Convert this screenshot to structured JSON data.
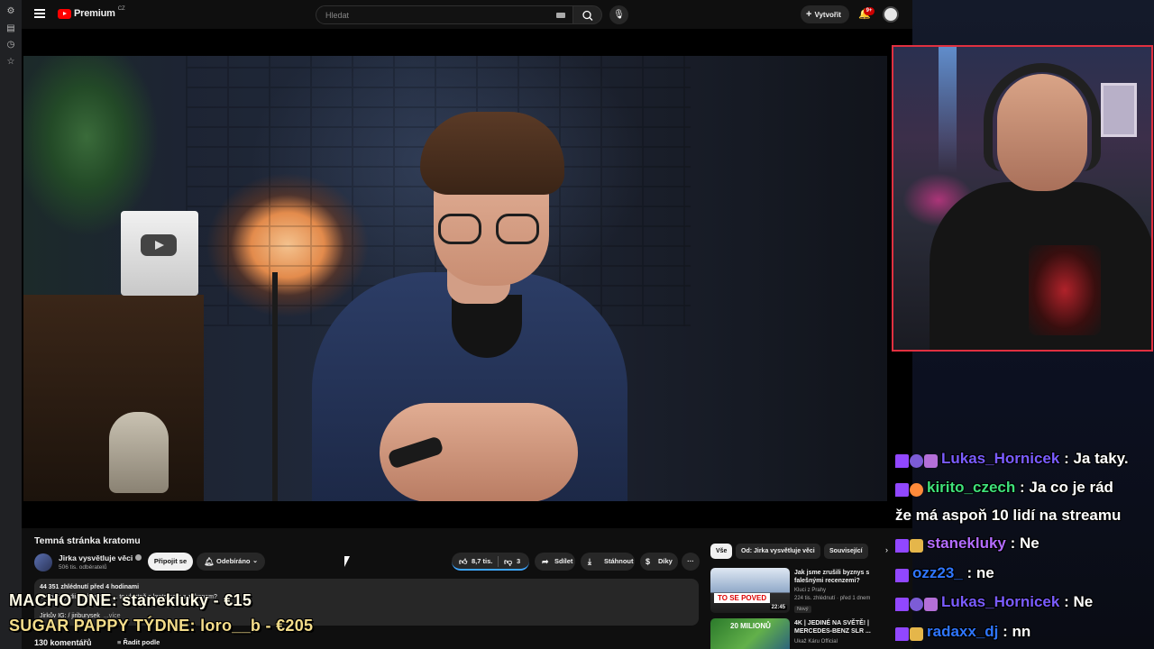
{
  "youtube": {
    "brand": "Premium",
    "country": "CZ",
    "search_placeholder": "Hledat",
    "create_label": "Vytvořit",
    "notifications_badge": "9+",
    "video_title": "Temná stránka kratomu",
    "channel_name": "Jirka vysvětluje věci",
    "subscribers": "506 tis. odběratelů",
    "join_label": "Připojit se",
    "subscribed_label": "Odebíráno",
    "likes": "8,7 tis.",
    "dislikes": "3",
    "share_label": "Sdílet",
    "download_label": "Stáhnout",
    "thanks_label": "Díky",
    "more_label": "···",
    "description": {
      "meta": "44 351 zhlédnutí  před 4 hodinami",
      "line2": "ide o tragédii... závislost? ... to vlastně s kratomem a zákonem?",
      "line3": "Jirkův IG:  / jiriburysek",
      "more": "...více"
    },
    "comments_count": "130 komentářů",
    "sort_label": "Řadit podle",
    "chips": [
      "Vše",
      "Od: Jirka vysvětluje věci",
      "Související"
    ],
    "recommendations": [
      {
        "title": "Jak jsme zrušili byznys s falešnými recenzemi?",
        "channel": "Kluci z Prahy",
        "meta": "224 tis. zhlédnutí · před 1 dnem",
        "badge": "Nový",
        "duration": "22:45",
        "thumb_text": "TO SE POVED"
      },
      {
        "title": "4K | JEDINÉ NA SVĚTĚ! | MERCEDES-BENZ SLR ...",
        "channel": "Ukaž Káru Official",
        "meta": "",
        "badge": "",
        "duration": "",
        "thumb_text": "20 MILIONŮ"
      }
    ]
  },
  "chat": [
    {
      "user": "Lukas_Hornicek",
      "message": "Ja taky.",
      "color": "#7a5cff",
      "badges": [
        "tw",
        "sub",
        "gift"
      ]
    },
    {
      "user": "kirito_czech",
      "message": "Ja co je rád",
      "color": "#3fe07a",
      "badges": [
        "tw",
        "cheer"
      ]
    },
    {
      "user": "",
      "message": "že má aspoň 10 lidí na streamu",
      "color": "#ffffff",
      "badges": []
    },
    {
      "user": "stanekluky",
      "message": "Ne",
      "color": "#b36cff",
      "badges": [
        "tw",
        "vip"
      ]
    },
    {
      "user": "ozz23_",
      "message": "ne",
      "color": "#2f76ff",
      "badges": [
        "tw"
      ]
    },
    {
      "user": "Lukas_Hornicek",
      "message": "Ne",
      "color": "#7a5cff",
      "badges": [
        "tw",
        "sub",
        "gift"
      ]
    },
    {
      "user": "radaxx_dj",
      "message": "nn",
      "color": "#2f76ff",
      "badges": [
        "tw",
        "vip"
      ]
    }
  ],
  "overlay": {
    "line1": "MACHO DNE: stanekluky - €15",
    "line2": "SUGAR PAPPY TÝDNE: loro__b - €205"
  }
}
